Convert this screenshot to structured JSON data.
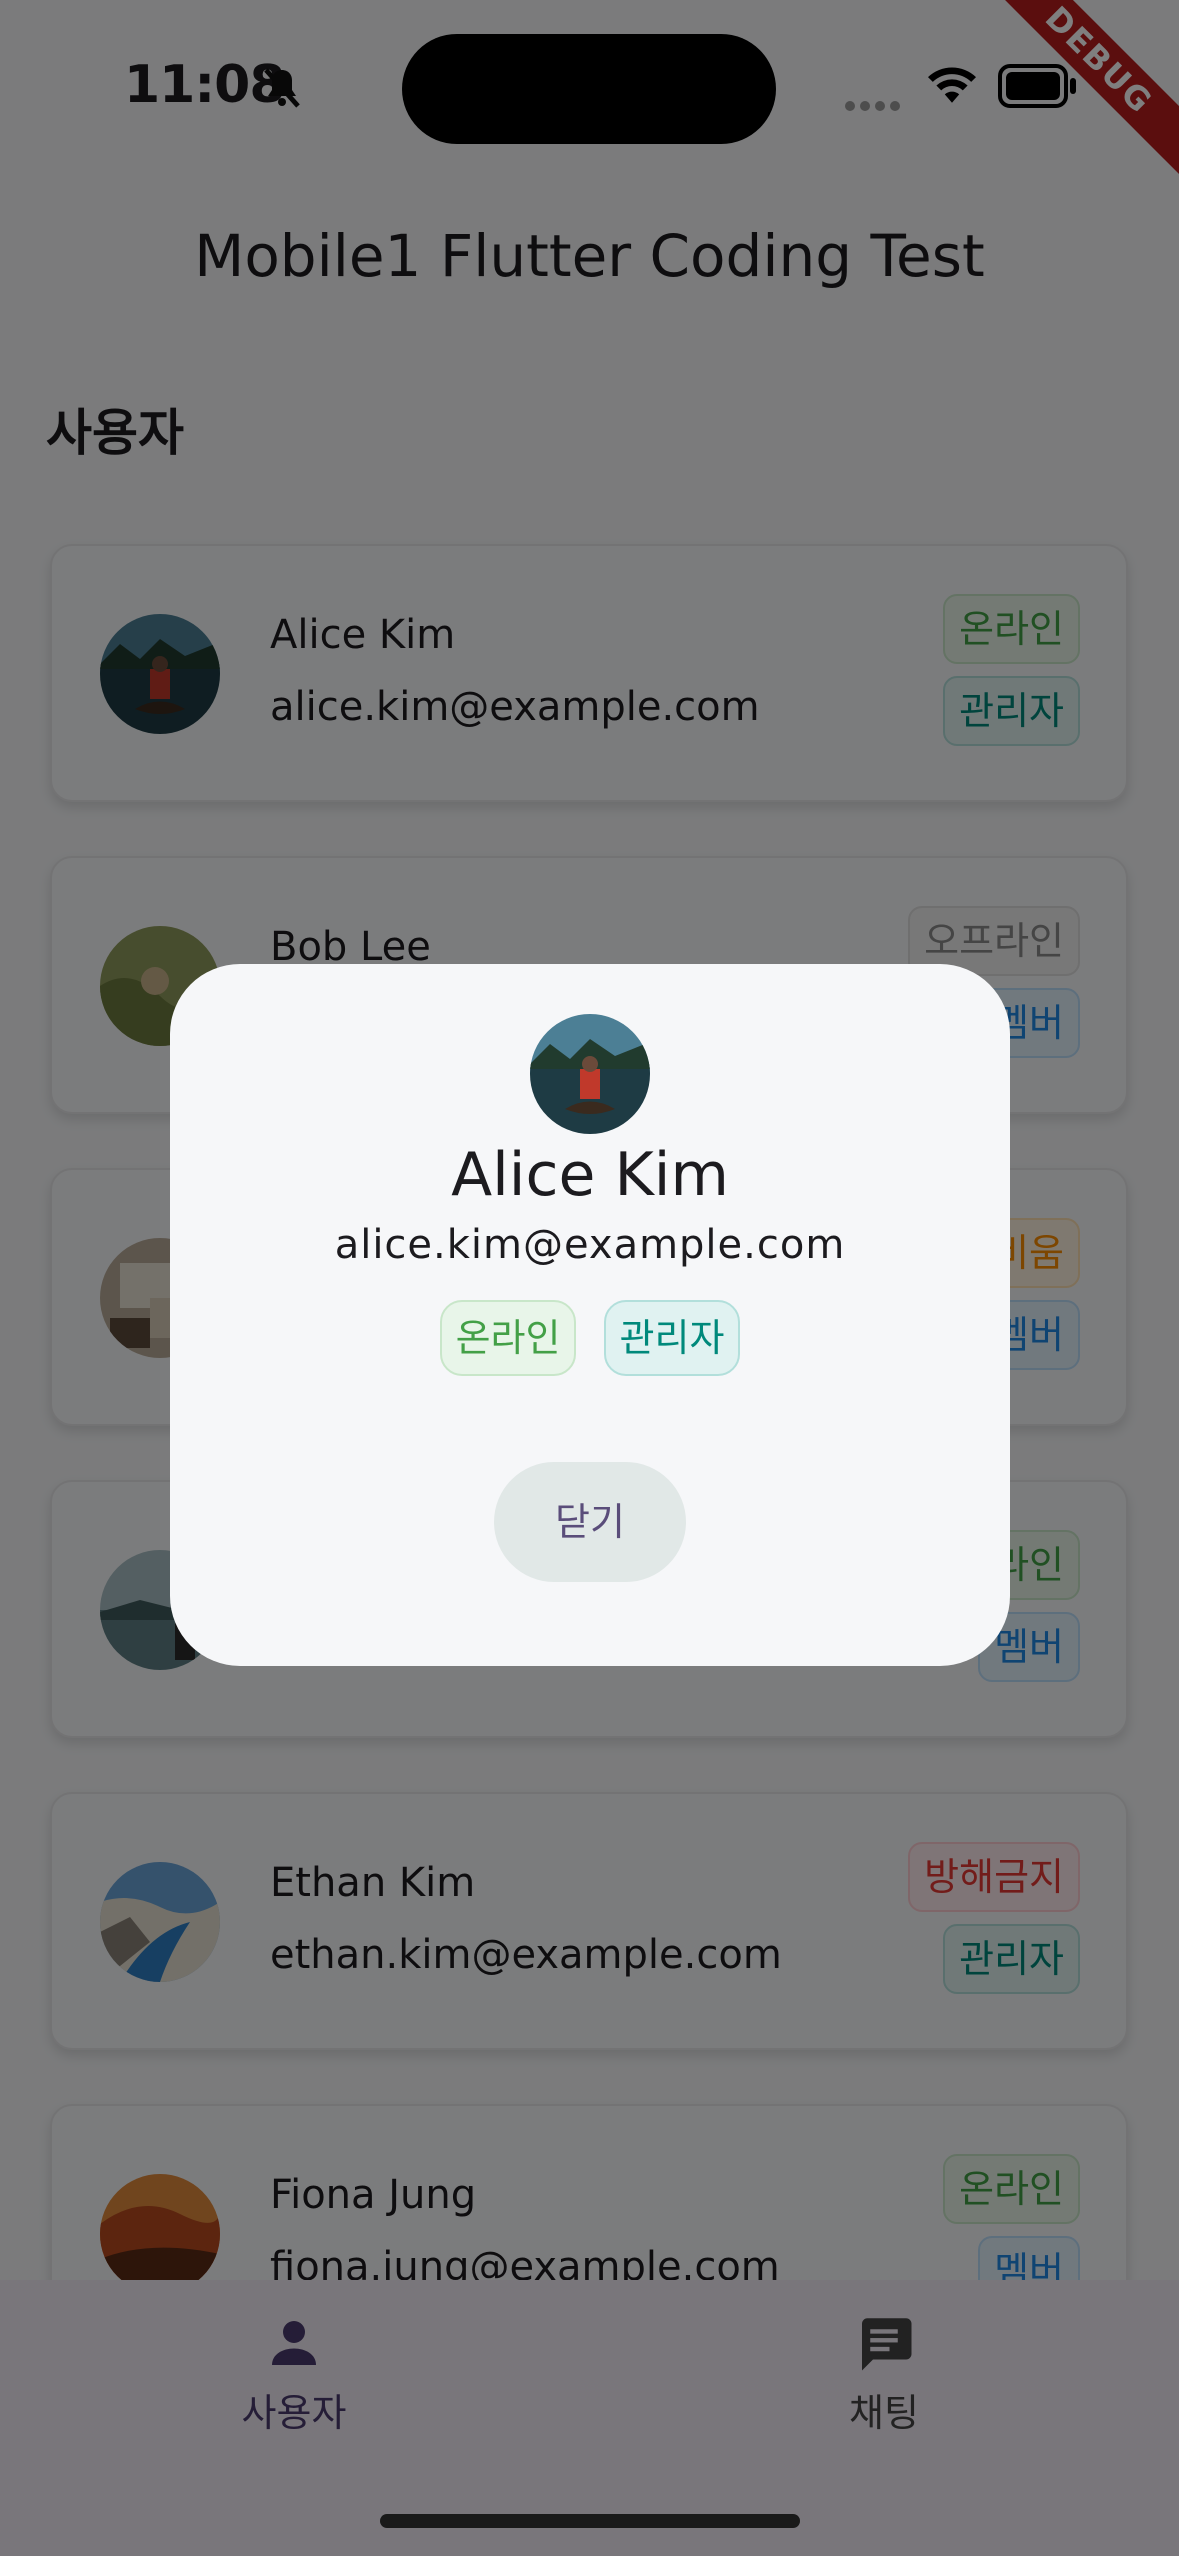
{
  "status_bar": {
    "time": "11:08",
    "debug_label": "DEBUG"
  },
  "app": {
    "title": "Mobile1 Flutter Coding Test",
    "section_title": "사용자"
  },
  "users": [
    {
      "name": "Alice Kim",
      "email": "alice.kim@example.com",
      "status": "온라인",
      "role": "관리자"
    },
    {
      "name": "Bob Lee",
      "email": "",
      "status": "오프라인",
      "role": "멤버"
    },
    {
      "name": "",
      "email": "",
      "status": "비움",
      "role": "멤버"
    },
    {
      "name": "",
      "email": "",
      "status": "라인",
      "role": "멤버"
    },
    {
      "name": "Ethan Kim",
      "email": "ethan.kim@example.com",
      "status": "방해금지",
      "role": "관리자"
    },
    {
      "name": "Fiona Jung",
      "email": "fiona.jung@example.com",
      "status": "온라인",
      "role": "멤버"
    }
  ],
  "dialog": {
    "name": "Alice Kim",
    "email": "alice.kim@example.com",
    "status": "온라인",
    "role": "관리자",
    "close_label": "닫기"
  },
  "bottom_nav": {
    "users_label": "사용자",
    "chat_label": "채팅",
    "active": "users"
  },
  "colors": {
    "accent": "#4a3b6e",
    "online": "#43a047",
    "admin": "#00897b",
    "member": "#1e88e5",
    "away": "#fb8c00",
    "dnd": "#e53935",
    "offline": "#8a8a8a"
  }
}
